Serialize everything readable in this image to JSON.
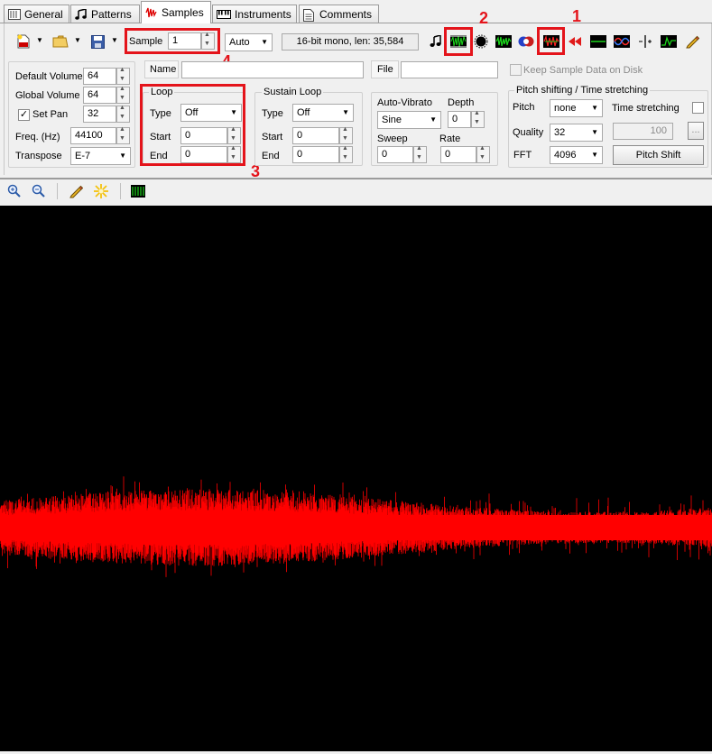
{
  "tabs": [
    {
      "label": "General",
      "icon": "general-icon"
    },
    {
      "label": "Patterns",
      "icon": "note-icon"
    },
    {
      "label": "Samples",
      "icon": "waveform-icon"
    },
    {
      "label": "Instruments",
      "icon": "piano-icon"
    },
    {
      "label": "Comments",
      "icon": "document-icon"
    }
  ],
  "active_tab": "Samples",
  "toolbar": {
    "sample_label": "Sample",
    "sample_value": "1",
    "auto_value": "Auto",
    "sample_info": "16-bit mono, len: 35,584"
  },
  "props": {
    "default_volume_label": "Default Volume",
    "default_volume": "64",
    "global_volume_label": "Global Volume",
    "global_volume": "64",
    "set_pan_label": "Set Pan",
    "set_pan_checked": "✓",
    "set_pan": "32",
    "freq_label": "Freq. (Hz)",
    "freq": "44100",
    "transpose_label": "Transpose",
    "transpose": "E-7"
  },
  "name_label": "Name",
  "file_label": "File",
  "keep_label": "Keep Sample Data on Disk",
  "loop": {
    "title": "Loop",
    "type_label": "Type",
    "type": "Off",
    "start_label": "Start",
    "start": "0",
    "end_label": "End",
    "end": "0"
  },
  "sustain": {
    "title": "Sustain Loop",
    "type_label": "Type",
    "type": "Off",
    "start_label": "Start",
    "start": "0",
    "end_label": "End",
    "end": "0"
  },
  "vibrato": {
    "title": "Auto-Vibrato",
    "type": "Sine",
    "depth_label": "Depth",
    "depth": "0",
    "sweep_label": "Sweep",
    "sweep": "0",
    "rate_label": "Rate",
    "rate": "0"
  },
  "pitch": {
    "title": "Pitch shifting / Time stretching",
    "pitch_label": "Pitch",
    "pitch": "none",
    "stretch_label": "Time stretching",
    "quality_label": "Quality",
    "quality": "32",
    "stretch_value": "100",
    "browse": "...",
    "fft_label": "FFT",
    "fft": "4096",
    "button": "Pitch Shift"
  },
  "annotations": [
    "1",
    "2",
    "3",
    "4"
  ],
  "colors": {
    "annotation": "#e4141b",
    "waveform": "#ff0000",
    "background": "#000000"
  }
}
